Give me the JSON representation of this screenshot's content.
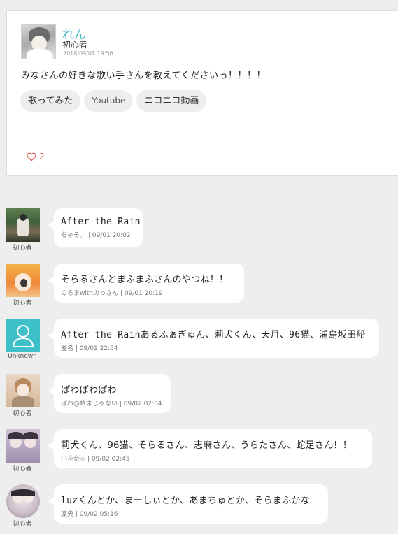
{
  "post": {
    "author": "れん",
    "rank": "初心者",
    "date": "2018/09/01 19:56",
    "body": "みなさんの好きな歌い手さんを教えてくださいっ！！！！",
    "tags": [
      "歌ってみた",
      "Youtube",
      "ニコニコ動画"
    ],
    "likes": "2"
  },
  "comments": [
    {
      "text": "After the Rain",
      "author": "ちゃそ。",
      "time": "09/01 20:02",
      "rank": "初心者",
      "avatar": "photo-avatar"
    },
    {
      "text": "そらるさんとまふまふさんのやつね！！",
      "author": "のるまwithのっさん",
      "time": "09/01 20:19",
      "rank": "初心者",
      "avatar": "anime-avatar"
    },
    {
      "text": "After the Rainあるふぁぎゅん、莉犬くん、天月、96猫、浦島坂田船",
      "author": "匿名",
      "time": "09/01 22:54",
      "rank": "Unknown",
      "avatar": "default-user-icon"
    },
    {
      "text": "ぱわぱわぱわ",
      "author": "ぱわ@終末じゃない",
      "time": "09/02 02:04",
      "rank": "初心者",
      "avatar": "illustration-avatar"
    },
    {
      "text": "莉犬くん、96猫、そらるさん、志麻さん、うらたさん、蛇足さん！！",
      "author": "小花奈☆",
      "time": "09/02 02:45",
      "rank": "初心者",
      "avatar": "photo-avatar"
    },
    {
      "text": "luzくんとか、まーしぃとか、あまちゅとか、そらまふかな",
      "author": "凜央",
      "time": "09/02 05:16",
      "rank": "初心者",
      "avatar": "photo-avatar"
    }
  ],
  "colors": {
    "accent": "#3ab4bf",
    "like": "#d9534f",
    "background": "#eeeeee"
  }
}
